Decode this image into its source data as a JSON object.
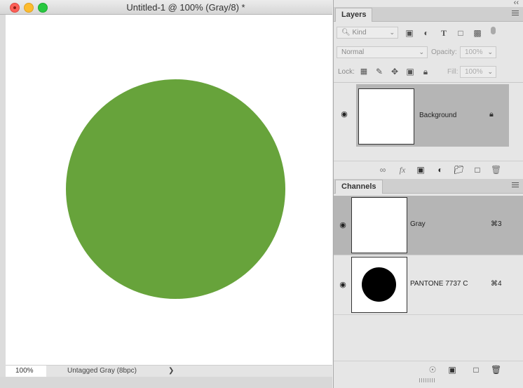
{
  "document": {
    "title": "Untitled-1 @ 100% (Gray/8) *",
    "canvas": {
      "background": "#ffffff",
      "shape_color": "#67a33b"
    },
    "status": {
      "zoom": "100%",
      "info": "Untagged Gray (8bpc)",
      "arrow": "❯"
    }
  },
  "panels": {
    "collapse": "‹‹",
    "layers": {
      "tab": "Layers",
      "filter": {
        "value": "Kind",
        "icons": [
          "image-filter-icon",
          "adjustment-filter-icon",
          "type-filter-icon",
          "shape-filter-icon",
          "smart-object-filter-icon"
        ]
      },
      "blend_mode": "Normal",
      "opacity_label": "Opacity:",
      "opacity_value": "100%",
      "lock_label": "Lock:",
      "fill_label": "Fill:",
      "fill_value": "100%",
      "items": [
        {
          "name": "Background",
          "visible": true,
          "locked": true
        }
      ],
      "footer_icons": [
        "link-icon",
        "fx-icon",
        "mask-icon",
        "adjustment-icon",
        "folder-icon",
        "new-layer-icon",
        "trash-icon"
      ],
      "fx_text": "fx"
    },
    "channels": {
      "tab": "Channels",
      "items": [
        {
          "name": "Gray",
          "shortcut": "⌘3",
          "visible": true,
          "selected": true
        },
        {
          "name": "PANTONE 7737 C",
          "shortcut": "⌘4",
          "visible": true,
          "selected": false
        }
      ],
      "footer_icons": [
        "load-selection-icon",
        "save-selection-icon",
        "new-channel-icon",
        "trash-icon"
      ]
    }
  }
}
